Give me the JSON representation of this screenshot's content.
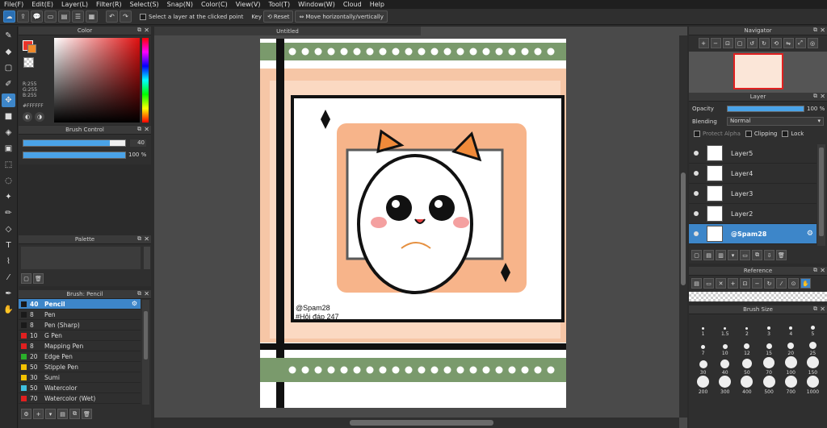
{
  "menu": [
    "File(F)",
    "Edit(E)",
    "Layer(L)",
    "Filter(R)",
    "Select(S)",
    "Snap(N)",
    "Color(C)",
    "View(V)",
    "Tool(T)",
    "Window(W)",
    "Cloud",
    "Help"
  ],
  "toolbar": {
    "select_layer_label": "Select a layer at the clicked point",
    "key_label": "Key",
    "reset_label": "Reset",
    "move_label": "Move horizontally/vertically"
  },
  "color_panel": {
    "title": "Color",
    "r": "R:255",
    "g": "G:255",
    "b": "B:255",
    "hex": "#FFFFFF",
    "foreground": "#e8342a",
    "background": "#ffffff"
  },
  "brush_control": {
    "title": "Brush Control",
    "size": "40",
    "opacity": "100 %",
    "size_fraction": 0.85,
    "opacity_fraction": 1.0
  },
  "palette": {
    "title": "Palette"
  },
  "brush_list": {
    "title": "Brush: Pencil",
    "items": [
      {
        "size": "40",
        "name": "Pencil",
        "color": "#1a1a1a",
        "selected": true
      },
      {
        "size": "8",
        "name": "Pen",
        "color": "#1a1a1a"
      },
      {
        "size": "8",
        "name": "Pen (Sharp)",
        "color": "#1a1a1a"
      },
      {
        "size": "10",
        "name": "G Pen",
        "color": "#e02020"
      },
      {
        "size": "8",
        "name": "Mapping Pen",
        "color": "#e02020"
      },
      {
        "size": "20",
        "name": "Edge Pen",
        "color": "#2ab02a"
      },
      {
        "size": "50",
        "name": "Stipple Pen",
        "color": "#f2c200"
      },
      {
        "size": "30",
        "name": "Sumi",
        "color": "#f2c200"
      },
      {
        "size": "50",
        "name": "Watercolor",
        "color": "#3fc0e0"
      },
      {
        "size": "70",
        "name": "Watercolor (Wet)",
        "color": "#e02020"
      }
    ]
  },
  "canvas": {
    "title": "Untitled"
  },
  "navigator": {
    "title": "Navigator"
  },
  "layer_panel": {
    "title": "Layer",
    "opacity_label": "Opacity",
    "opacity_value": "100 %",
    "blending_label": "Blending",
    "blending_value": "Normal",
    "protect_alpha": "Protect Alpha",
    "clipping": "Clipping",
    "lock": "Lock",
    "layers": [
      {
        "name": "Layer5"
      },
      {
        "name": "Layer4"
      },
      {
        "name": "Layer3"
      },
      {
        "name": "Layer2"
      },
      {
        "name": "@Spam28",
        "selected": true
      }
    ]
  },
  "reference": {
    "title": "Reference"
  },
  "brush_size": {
    "title": "Brush Size",
    "sizes": [
      "1",
      "1.5",
      "2",
      "3",
      "4",
      "5",
      "7",
      "10",
      "12",
      "15",
      "20",
      "25",
      "30",
      "40",
      "50",
      "70",
      "100",
      "150",
      "200",
      "300",
      "400",
      "500",
      "700",
      "1000"
    ]
  },
  "artwork": {
    "signature": "@Spam28",
    "caption": "#Hỏi đáp 247"
  }
}
